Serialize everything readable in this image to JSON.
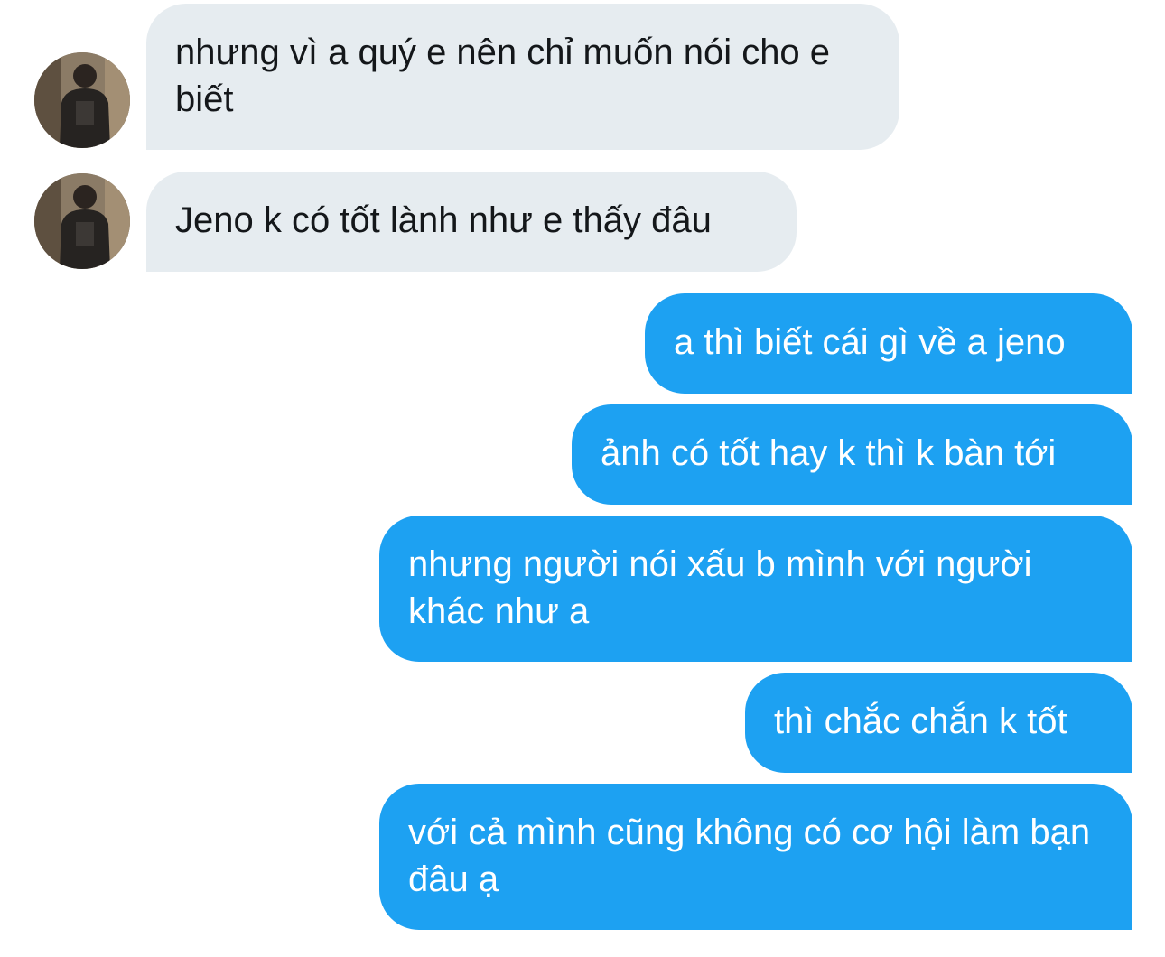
{
  "thread": {
    "incoming": [
      {
        "text": "nhưng vì a quý e nên chỉ muốn nói cho e biết"
      },
      {
        "text": "Jeno k có tốt lành như e thấy đâu"
      }
    ],
    "outgoing": [
      {
        "text": "a thì biết cái gì về a jeno"
      },
      {
        "text": "ảnh có tốt hay k thì k bàn tới"
      },
      {
        "text": "nhưng người nói xấu b mình với người khác như a"
      },
      {
        "text": "thì chắc chắn k tốt"
      },
      {
        "text": "với cả mình cũng không có cơ hội làm bạn đâu ạ"
      }
    ]
  },
  "colors": {
    "incoming_bubble": "#e6ecf0",
    "outgoing_bubble": "#1da1f2",
    "incoming_text": "#14171a",
    "outgoing_text": "#ffffff"
  },
  "icons": {
    "avatar": "user-avatar-photo"
  }
}
